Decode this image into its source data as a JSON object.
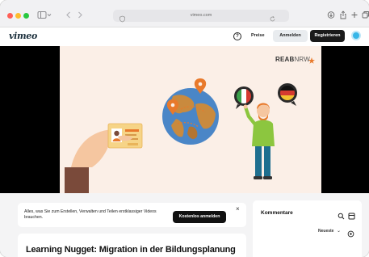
{
  "browser": {
    "url": "vimeo.com"
  },
  "header": {
    "logo": "vimeo",
    "help_icon": "?",
    "pricing": "Preise",
    "login": "Anmelden",
    "register": "Registrieren"
  },
  "video": {
    "brand_logo_bold": "REAB",
    "brand_logo_light": "NRW"
  },
  "promo": {
    "text": "Alles, was Sie zum Erstellen, Verwalten und Teilen erstklassiger Videos brauchen.",
    "button": "Kostenlos anmelden",
    "close": "×"
  },
  "title": {
    "text": "Learning Nugget: Migration in der Bildungsplanung"
  },
  "comments": {
    "title": "Kommentare",
    "sort": "Neueste",
    "sort_chevron": "⌄"
  },
  "colors": {
    "accent": "#37b6e8",
    "video_bg": "#fbefe7",
    "globe_ocean": "#4a86c7",
    "globe_land": "#c98a3e",
    "pin": "#e8792b"
  }
}
